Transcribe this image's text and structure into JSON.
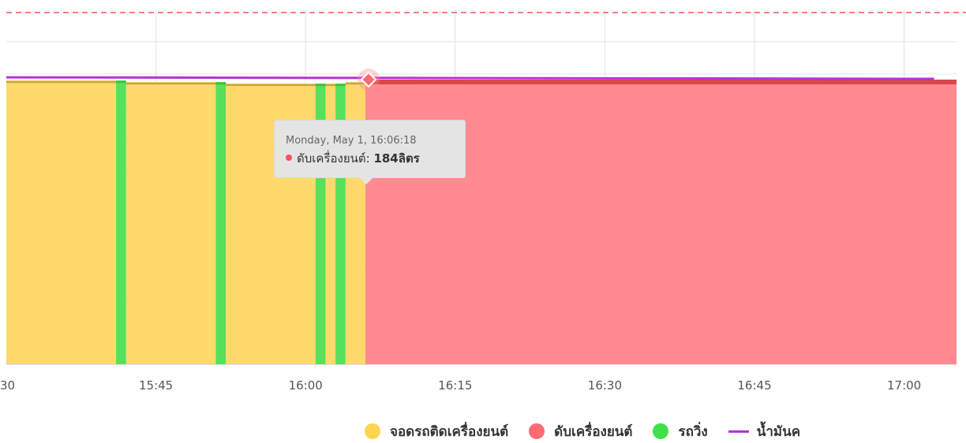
{
  "chart_data": {
    "type": "area",
    "x_axis": {
      "ticks": [
        "30",
        "15:45",
        "16:00",
        "16:15",
        "16:30",
        "16:45",
        "17:00"
      ],
      "range": [
        "15:30",
        "17:03"
      ]
    },
    "series": [
      {
        "name": "จอดรถติดเครื่องยนต์",
        "color": "#ffd96a",
        "segments": [
          {
            "start": "15:30",
            "end": "15:41",
            "value": 184
          },
          {
            "start": "15:42",
            "end": "15:51",
            "value": 183
          },
          {
            "start": "15:52",
            "end": "16:01",
            "value": 182
          },
          {
            "start": "16:02",
            "end": "16:03",
            "value": 182
          },
          {
            "start": "16:04",
            "end": "16:06",
            "value": 183
          }
        ]
      },
      {
        "name": "ดับเครื่องยนต์",
        "color": "#ff8a90",
        "segments": [
          {
            "start": "16:06",
            "end": "17:03",
            "value": 184
          }
        ]
      },
      {
        "name": "รถวิ่ง",
        "color": "#57e05b",
        "segments": [
          {
            "start": "15:41",
            "end": "15:42",
            "value": 184
          },
          {
            "start": "15:51",
            "end": "15:52",
            "value": 183
          },
          {
            "start": "16:01",
            "end": "16:02",
            "value": 182
          },
          {
            "start": "16:03",
            "end": "16:04",
            "value": 182
          }
        ]
      },
      {
        "name": "น้ำมันค",
        "color": "#b733d6",
        "type": "line",
        "points": [
          {
            "x": "15:30",
            "y": 186
          },
          {
            "x": "17:03",
            "y": 185
          }
        ]
      }
    ],
    "y_axis": {
      "ylim": [
        0,
        230
      ],
      "gridlines": 10,
      "max_threshold": {
        "value": 228,
        "color": "#f05a5a",
        "style": "dashed"
      }
    },
    "tooltip": {
      "time": "Monday, May 1, 16:06:18",
      "series": "ดับเครื่องยนต์",
      "label": "ดับเครื่องยนต์:",
      "value": "184ลิตร",
      "dot_color": "#f7525e"
    },
    "legend": [
      {
        "label": "จอดรถติดเครื่องยนต์",
        "color": "#ffd54f",
        "marker": "circle"
      },
      {
        "label": "ดับเครื่องยนต์",
        "color": "#ff6b72",
        "marker": "circle"
      },
      {
        "label": "รถวิ่ง",
        "color": "#3fe04a",
        "marker": "circle"
      },
      {
        "label": "น้ำมันค",
        "color": "#b733d6",
        "marker": "line"
      }
    ],
    "legend_position": "bottom",
    "grid": true
  }
}
